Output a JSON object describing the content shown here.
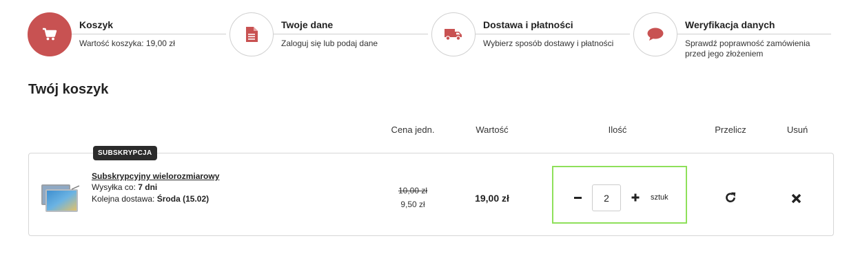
{
  "steps": [
    {
      "title": "Koszyk",
      "description": "Wartość koszyka: 19,00 zł",
      "icon": "cart-icon",
      "active": true
    },
    {
      "title": "Twoje dane",
      "description": "Zaloguj się lub podaj dane",
      "icon": "document-icon",
      "active": false
    },
    {
      "title": "Dostawa i płatności",
      "description": "Wybierz sposób dostawy i płatności",
      "icon": "truck-icon",
      "active": false
    },
    {
      "title": "Weryfikacja danych",
      "description": "Sprawdź poprawność zamówienia przed jego złożeniem",
      "icon": "speech-bubble-icon",
      "active": false
    }
  ],
  "cart": {
    "title": "Twój koszyk",
    "columns": {
      "unit_price": "Cena jedn.",
      "value": "Wartość",
      "quantity": "Ilość",
      "recalculate": "Przelicz",
      "remove": "Usuń"
    },
    "item": {
      "badge": "SUBSKRYPCJA",
      "name": "Subskrypcyjny wielorozmiarowy",
      "shipping_label": "Wysyłka co:",
      "shipping_value": "7 dni",
      "next_delivery_label": "Kolejna dostawa:",
      "next_delivery_value": "Środa (15.02)",
      "old_price": "10,00 zł",
      "unit_price": "9,50 zł",
      "total": "19,00 zł",
      "quantity": "2",
      "unit": "sztuk"
    }
  },
  "colors": {
    "accent": "#c85252",
    "highlight": "#8ee05a"
  }
}
